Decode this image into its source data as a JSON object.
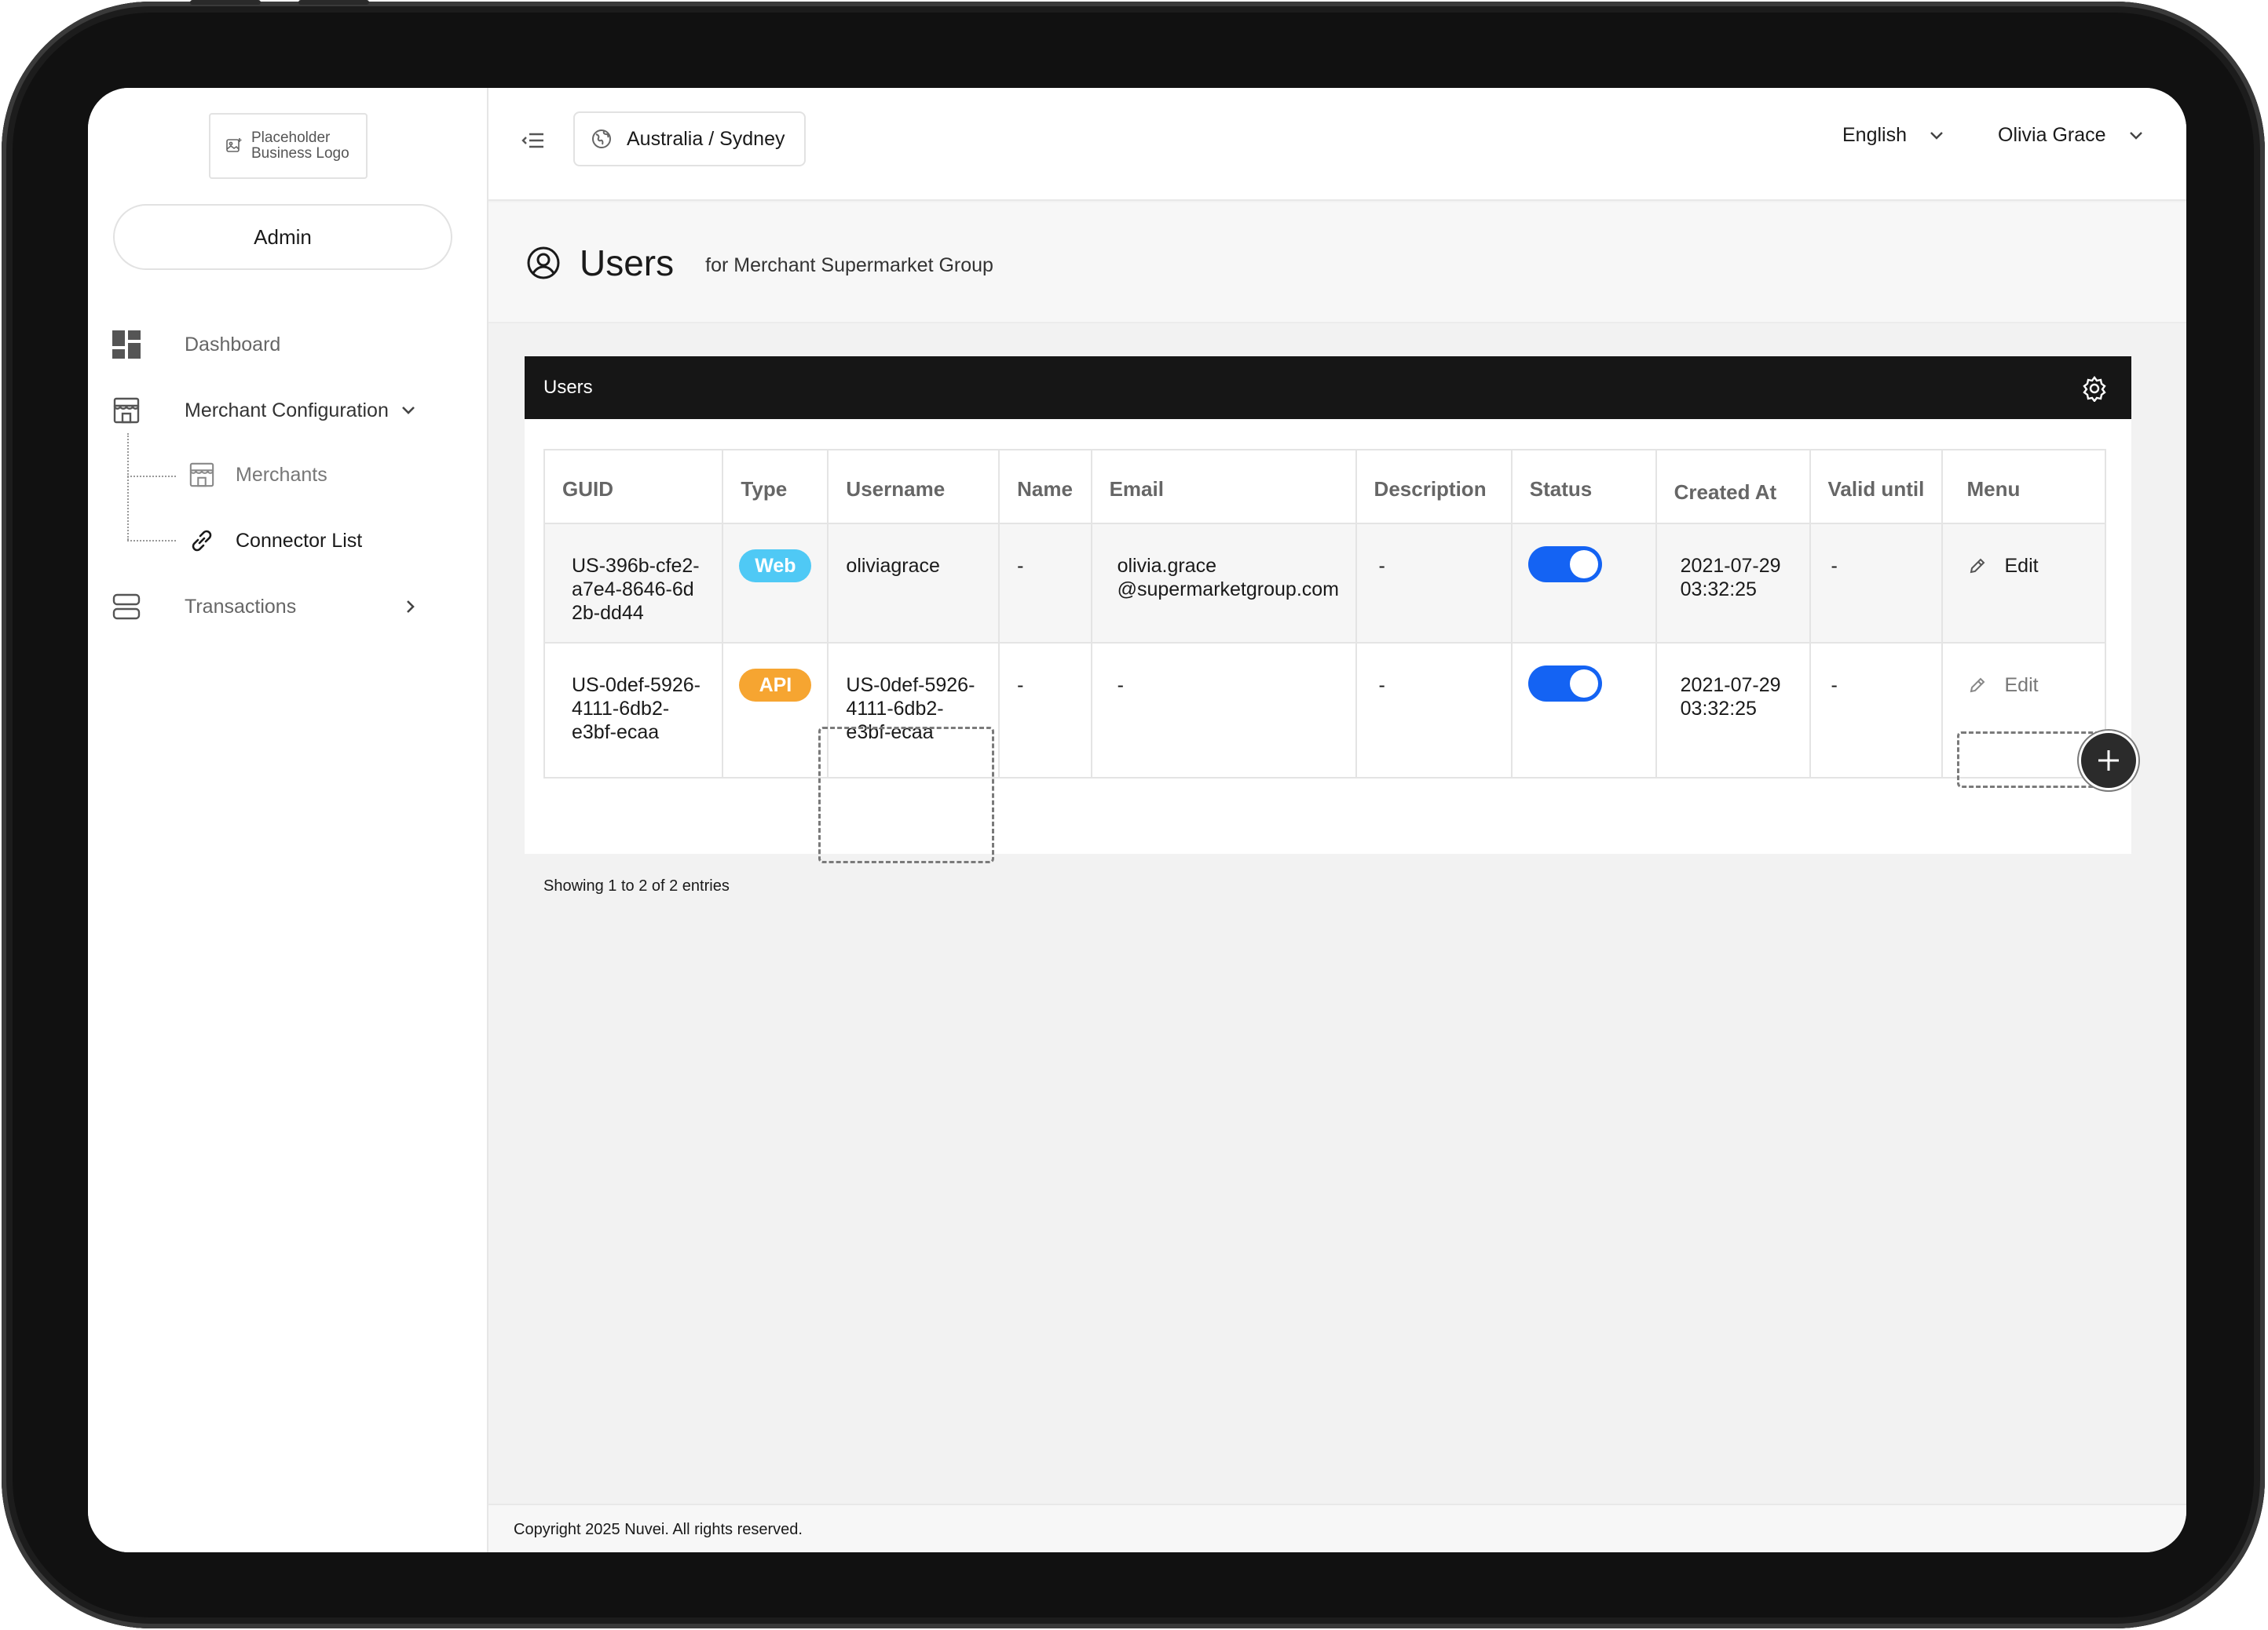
{
  "sidebar": {
    "logo_text": "Placeholder Business Logo",
    "logo_line1": "Placeholder",
    "logo_line2": "Business Logo",
    "role_button": "Admin",
    "items": [
      {
        "label": "Dashboard",
        "icon": "dashboard-icon"
      },
      {
        "label": "Merchant Configuration",
        "icon": "storefront-icon",
        "expanded": true
      },
      {
        "label": "Transactions",
        "icon": "layers-icon"
      }
    ],
    "sub_items": [
      {
        "label": "Merchants",
        "icon": "storefront-icon"
      },
      {
        "label": "Connector List",
        "icon": "link-icon",
        "active": true
      }
    ]
  },
  "header": {
    "timezone": "Australia / Sydney",
    "language": "English",
    "user_name": "Olivia Grace"
  },
  "page": {
    "title": "Users",
    "subtitle": "for Merchant Supermarket Group"
  },
  "card": {
    "title": "Users",
    "columns": [
      "GUID",
      "Type",
      "Username",
      "Name",
      "Email",
      "Description",
      "Status",
      "Created At",
      "Valid until",
      "Menu"
    ],
    "rows": [
      {
        "guid_lines": [
          "US-396b-cfe2-",
          "a7e4-8646-6d",
          "2b-dd44"
        ],
        "type": "Web",
        "username_lines": [
          "oliviagrace"
        ],
        "name": "-",
        "email_lines": [
          "olivia.grace",
          "@supermarketgroup.com"
        ],
        "description": "-",
        "status": true,
        "created_lines": [
          "2021-07-29",
          "03:32:25"
        ],
        "valid_until": "-",
        "menu_label": "Edit"
      },
      {
        "guid_lines": [
          "US-0def-5926-",
          "4111-6db2-",
          "e3bf-ecaa"
        ],
        "type": "API",
        "username_lines": [
          "US-0def-5926-",
          "4111-6db2-",
          "e3bf-ecaa"
        ],
        "name": "-",
        "email_lines": [
          "-"
        ],
        "description": "-",
        "status": true,
        "created_lines": [
          "2021-07-29",
          "03:32:25"
        ],
        "valid_until": "-",
        "menu_label": "Edit"
      }
    ],
    "entries_text": "Showing 1 to 2 of 2 entries"
  },
  "footer": {
    "copyright": "Copyright 2025 Nuvei. All rights reserved."
  },
  "colors": {
    "toggle_on": "#1463f3",
    "badge_web": "#4fc9f5",
    "badge_api": "#f6a531",
    "card_header": "#161616"
  }
}
